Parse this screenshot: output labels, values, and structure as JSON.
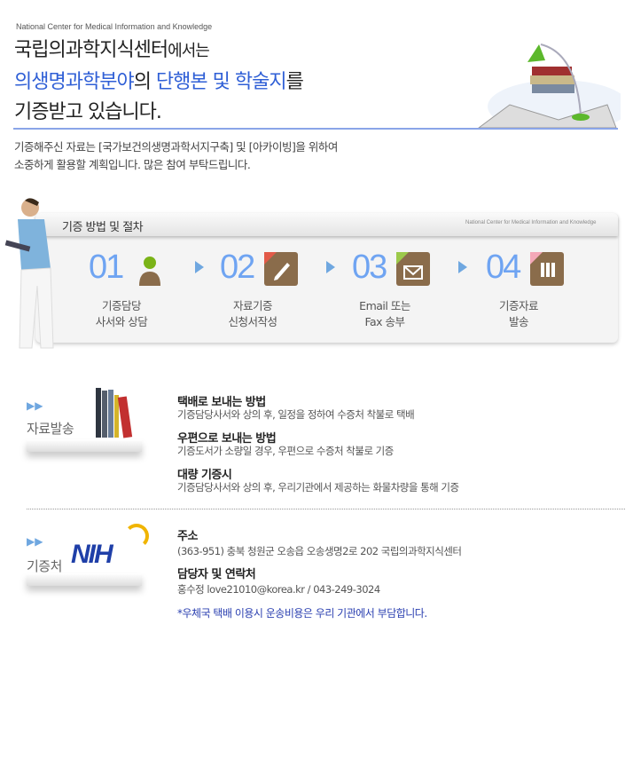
{
  "header": {
    "org": "National Center for Medical Information and Knowledge",
    "line1_a": "국립의과학지식센터",
    "line1_b": "에서는",
    "line2_a": "의생명과학분야",
    "line2_b": "의 ",
    "line2_c": "단행본 및 학술지",
    "line2_d": "를",
    "line3": "기증받고 있습니다.",
    "intro1": "기증해주신 자료는 [국가보건의생명과학서지구축] 및 [아카이빙]을 위하여",
    "intro2": "소중하게 활용할 계획입니다. 많은 참여 부탁드립니다."
  },
  "procedure": {
    "title": "기증 방법 및 절차",
    "org": "National Center for Medical Information and Knowledge",
    "steps": [
      {
        "num": "01",
        "icon": "person-icon",
        "l1": "기증담당",
        "l2": "사서와 상담"
      },
      {
        "num": "02",
        "icon": "pencil-document-icon",
        "l1": "자료기증",
        "l2": "신청서작성"
      },
      {
        "num": "03",
        "icon": "envelope-icon",
        "l1": "Email 또는",
        "l2": "Fax 송부"
      },
      {
        "num": "04",
        "icon": "binders-icon",
        "l1": "기증자료",
        "l2": "발송"
      }
    ]
  },
  "shipping": {
    "label": "자료발송",
    "items": [
      {
        "title": "택배로 보내는 방법",
        "desc": "기증담당사서와 상의 후, 일정을 정하여 수증처 착불로 택배"
      },
      {
        "title": "우편으로 보내는 방법",
        "desc": "기증도서가 소량일 경우, 우편으로 수증처 착불로 기증"
      },
      {
        "title": "대량 기증시",
        "desc": "기증담당사서와 상의 후, 우리기관에서 제공하는 화물차량을 통해 기증"
      }
    ]
  },
  "recipient": {
    "label": "기증처",
    "logo": "NIH",
    "address_title": "주소",
    "address": "(363-951) 충북 청원군 오송읍 오송생명2로 202 국립의과학지식센터",
    "contact_title": "담당자 및 연락처",
    "contact": "홍수정 love21010@korea.kr / 043-249-3024",
    "note": "*우체국 택배 이용시 운송비용은 우리 기관에서 부담합니다."
  },
  "colors": {
    "accent": "#2f5fd6",
    "step_num": "#6fa4f2",
    "icon_bg": "#8a6c4b"
  }
}
